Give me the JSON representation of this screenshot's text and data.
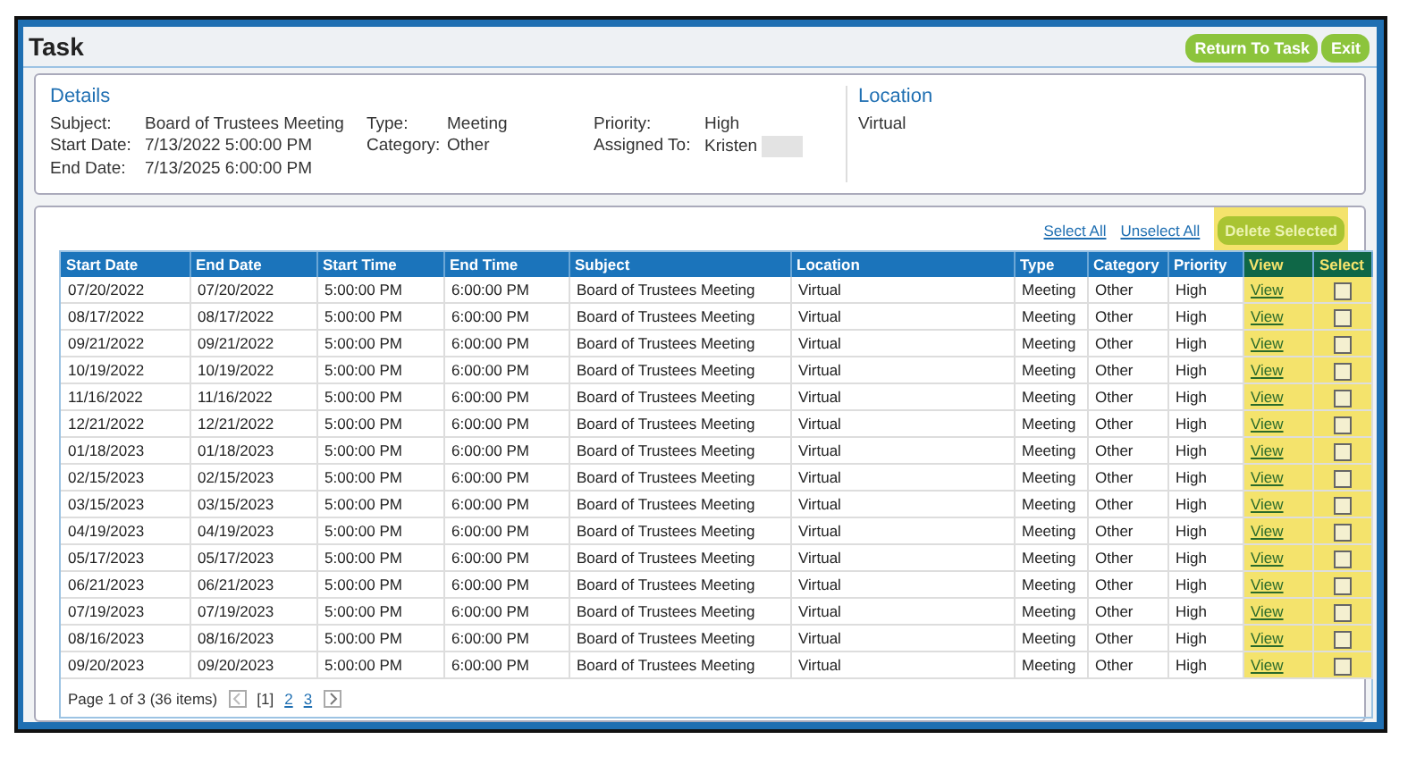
{
  "window": {
    "title": "Task",
    "buttons": [
      {
        "label": "Return To Task"
      },
      {
        "label": "Exit"
      }
    ]
  },
  "details": {
    "heading": "Details",
    "fields": [
      {
        "label": "Subject:",
        "value": "Board of Trustees Meeting"
      },
      {
        "label": "Start Date:",
        "value": "7/13/2022 5:00:00 PM"
      },
      {
        "label": "End Date:",
        "value": "7/13/2025 6:00:00 PM"
      },
      {
        "label": "Type:",
        "value": "Meeting"
      },
      {
        "label": "Category:",
        "value": "Other"
      },
      {
        "label": "Priority:",
        "value": "High"
      },
      {
        "label": "Assigned To:",
        "value": "Kristen",
        "redacted": true
      }
    ]
  },
  "location": {
    "heading": "Location",
    "value": "Virtual"
  },
  "grid": {
    "links": [
      "Select All",
      "Unselect All"
    ],
    "delete_button": "Delete Selected",
    "columns": [
      "Start Date",
      "End Date",
      "Start Time",
      "End Time",
      "Subject",
      "Location",
      "Type",
      "Category",
      "Priority",
      "View",
      "Select"
    ],
    "rows": [
      {
        "cells": [
          "07/20/2022",
          "07/20/2022",
          "5:00:00 PM",
          "6:00:00 PM",
          "Board of Trustees Meeting",
          "Virtual",
          "Meeting",
          "Other",
          "High"
        ],
        "view": "View",
        "checked": false
      },
      {
        "cells": [
          "08/17/2022",
          "08/17/2022",
          "5:00:00 PM",
          "6:00:00 PM",
          "Board of Trustees Meeting",
          "Virtual",
          "Meeting",
          "Other",
          "High"
        ],
        "view": "View",
        "checked": false
      },
      {
        "cells": [
          "09/21/2022",
          "09/21/2022",
          "5:00:00 PM",
          "6:00:00 PM",
          "Board of Trustees Meeting",
          "Virtual",
          "Meeting",
          "Other",
          "High"
        ],
        "view": "View",
        "checked": false
      },
      {
        "cells": [
          "10/19/2022",
          "10/19/2022",
          "5:00:00 PM",
          "6:00:00 PM",
          "Board of Trustees Meeting",
          "Virtual",
          "Meeting",
          "Other",
          "High"
        ],
        "view": "View",
        "checked": false
      },
      {
        "cells": [
          "11/16/2022",
          "11/16/2022",
          "5:00:00 PM",
          "6:00:00 PM",
          "Board of Trustees Meeting",
          "Virtual",
          "Meeting",
          "Other",
          "High"
        ],
        "view": "View",
        "checked": false
      },
      {
        "cells": [
          "12/21/2022",
          "12/21/2022",
          "5:00:00 PM",
          "6:00:00 PM",
          "Board of Trustees Meeting",
          "Virtual",
          "Meeting",
          "Other",
          "High"
        ],
        "view": "View",
        "checked": false
      },
      {
        "cells": [
          "01/18/2023",
          "01/18/2023",
          "5:00:00 PM",
          "6:00:00 PM",
          "Board of Trustees Meeting",
          "Virtual",
          "Meeting",
          "Other",
          "High"
        ],
        "view": "View",
        "checked": false
      },
      {
        "cells": [
          "02/15/2023",
          "02/15/2023",
          "5:00:00 PM",
          "6:00:00 PM",
          "Board of Trustees Meeting",
          "Virtual",
          "Meeting",
          "Other",
          "High"
        ],
        "view": "View",
        "checked": false
      },
      {
        "cells": [
          "03/15/2023",
          "03/15/2023",
          "5:00:00 PM",
          "6:00:00 PM",
          "Board of Trustees Meeting",
          "Virtual",
          "Meeting",
          "Other",
          "High"
        ],
        "view": "View",
        "checked": false
      },
      {
        "cells": [
          "04/19/2023",
          "04/19/2023",
          "5:00:00 PM",
          "6:00:00 PM",
          "Board of Trustees Meeting",
          "Virtual",
          "Meeting",
          "Other",
          "High"
        ],
        "view": "View",
        "checked": false
      },
      {
        "cells": [
          "05/17/2023",
          "05/17/2023",
          "5:00:00 PM",
          "6:00:00 PM",
          "Board of Trustees Meeting",
          "Virtual",
          "Meeting",
          "Other",
          "High"
        ],
        "view": "View",
        "checked": false
      },
      {
        "cells": [
          "06/21/2023",
          "06/21/2023",
          "5:00:00 PM",
          "6:00:00 PM",
          "Board of Trustees Meeting",
          "Virtual",
          "Meeting",
          "Other",
          "High"
        ],
        "view": "View",
        "checked": false
      },
      {
        "cells": [
          "07/19/2023",
          "07/19/2023",
          "5:00:00 PM",
          "6:00:00 PM",
          "Board of Trustees Meeting",
          "Virtual",
          "Meeting",
          "Other",
          "High"
        ],
        "view": "View",
        "checked": false
      },
      {
        "cells": [
          "08/16/2023",
          "08/16/2023",
          "5:00:00 PM",
          "6:00:00 PM",
          "Board of Trustees Meeting",
          "Virtual",
          "Meeting",
          "Other",
          "High"
        ],
        "view": "View",
        "checked": false
      },
      {
        "cells": [
          "09/20/2023",
          "09/20/2023",
          "5:00:00 PM",
          "6:00:00 PM",
          "Board of Trustees Meeting",
          "Virtual",
          "Meeting",
          "Other",
          "High"
        ],
        "view": "View",
        "checked": false
      }
    ],
    "pager": {
      "summary": "Page 1 of 3 (36 items)",
      "pages": [
        {
          "label": "[1]",
          "selected": true
        },
        {
          "label": "2",
          "selected": false
        },
        {
          "label": "3",
          "selected": false
        }
      ]
    }
  }
}
